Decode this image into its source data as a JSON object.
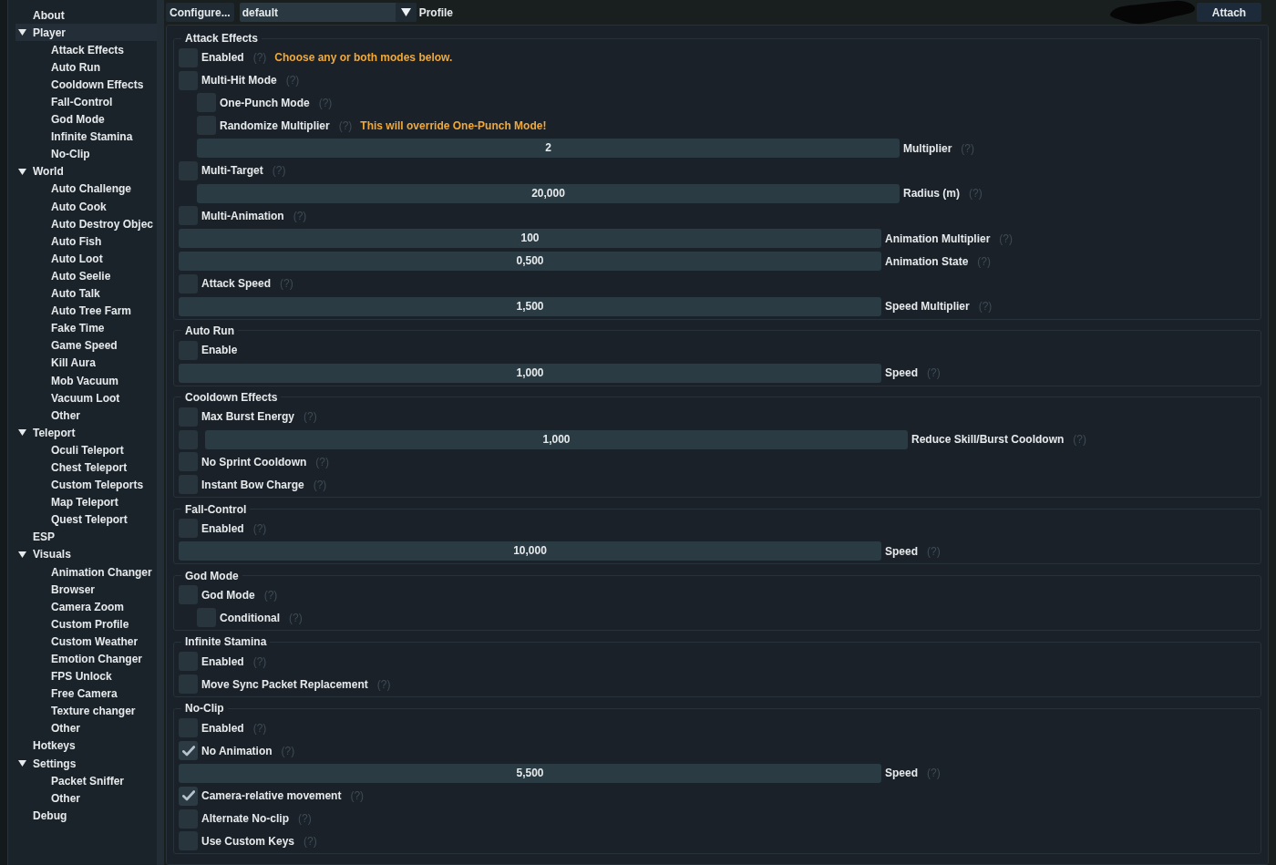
{
  "top_bar": {
    "configure_button": "Configure...",
    "profile_select": {
      "value": "default"
    },
    "profile_label": "Profile",
    "attach_button": "Attach"
  },
  "sidebar": {
    "items": [
      {
        "label": "About",
        "selected": false
      },
      {
        "label": "Player",
        "selected": true,
        "expanded": true,
        "children": [
          {
            "label": "Attack Effects",
            "selected": false
          },
          {
            "label": "Auto Run",
            "selected": false
          },
          {
            "label": "Cooldown Effects",
            "selected": false
          },
          {
            "label": "Fall-Control",
            "selected": false
          },
          {
            "label": "God Mode",
            "selected": false
          },
          {
            "label": "Infinite Stamina",
            "selected": false
          },
          {
            "label": "No-Clip",
            "selected": false
          }
        ]
      },
      {
        "label": "World",
        "selected": false,
        "expanded": true,
        "children": [
          {
            "label": "Auto Challenge",
            "selected": false
          },
          {
            "label": "Auto Cook",
            "selected": false
          },
          {
            "label": "Auto Destroy Objec",
            "selected": false
          },
          {
            "label": "Auto Fish",
            "selected": false
          },
          {
            "label": "Auto Loot",
            "selected": false
          },
          {
            "label": "Auto Seelie",
            "selected": false
          },
          {
            "label": "Auto Talk",
            "selected": false
          },
          {
            "label": "Auto Tree Farm",
            "selected": false
          },
          {
            "label": "Fake Time",
            "selected": false
          },
          {
            "label": "Game Speed",
            "selected": false
          },
          {
            "label": "Kill Aura",
            "selected": false
          },
          {
            "label": "Mob Vacuum",
            "selected": false
          },
          {
            "label": "Vacuum Loot",
            "selected": false
          },
          {
            "label": "Other",
            "selected": false
          }
        ]
      },
      {
        "label": "Teleport",
        "selected": false,
        "expanded": true,
        "children": [
          {
            "label": "Oculi Teleport",
            "selected": false
          },
          {
            "label": "Chest Teleport",
            "selected": false
          },
          {
            "label": "Custom Teleports",
            "selected": false
          },
          {
            "label": "Map Teleport",
            "selected": false
          },
          {
            "label": "Quest Teleport",
            "selected": false
          }
        ]
      },
      {
        "label": "ESP",
        "selected": false
      },
      {
        "label": "Visuals",
        "selected": false,
        "expanded": true,
        "children": [
          {
            "label": "Animation Changer",
            "selected": false
          },
          {
            "label": "Browser",
            "selected": false
          },
          {
            "label": "Camera Zoom",
            "selected": false
          },
          {
            "label": "Custom Profile",
            "selected": false
          },
          {
            "label": "Custom Weather",
            "selected": false
          },
          {
            "label": "Emotion Changer",
            "selected": false
          },
          {
            "label": "FPS Unlock",
            "selected": false
          },
          {
            "label": "Free Camera",
            "selected": false
          },
          {
            "label": "Texture changer",
            "selected": false
          },
          {
            "label": "Other",
            "selected": false
          }
        ]
      },
      {
        "label": "Hotkeys",
        "selected": false
      },
      {
        "label": "Settings",
        "selected": false,
        "expanded": true,
        "children": [
          {
            "label": "Packet Sniffer",
            "selected": false
          },
          {
            "label": "Other",
            "selected": false
          }
        ]
      },
      {
        "label": "Debug",
        "selected": false
      }
    ]
  },
  "groups": [
    {
      "title": "Attack Effects",
      "items": [
        {
          "kind": "checkbox",
          "label": "Enabled",
          "checked": false,
          "help": "(?)",
          "note": "Choose any or both modes below."
        },
        {
          "kind": "checkbox",
          "label": "Multi-Hit Mode",
          "checked": false,
          "help": "(?)",
          "children": [
            {
              "kind": "checkbox",
              "label": "One-Punch Mode",
              "checked": false,
              "help": "(?)"
            },
            {
              "kind": "checkbox",
              "label": "Randomize Multiplier",
              "checked": false,
              "help": "(?)",
              "note": "This will override One-Punch Mode!"
            },
            {
              "kind": "number",
              "value": "2",
              "label": "Multiplier",
              "help": "(?)"
            }
          ]
        },
        {
          "kind": "checkbox",
          "label": "Multi-Target",
          "checked": false,
          "help": "(?)",
          "children": [
            {
              "kind": "number",
              "value": "20,000",
              "label": "Radius (m)",
              "help": "(?)"
            }
          ]
        },
        {
          "kind": "checkbox",
          "label": "Multi-Animation",
          "checked": false,
          "help": "(?)"
        },
        {
          "kind": "number",
          "value": "100",
          "label": "Animation Multiplier",
          "help": "(?)"
        },
        {
          "kind": "number",
          "value": "0,500",
          "label": "Animation State",
          "help": "(?)"
        },
        {
          "kind": "checkbox",
          "label": "Attack Speed",
          "checked": false,
          "help": "(?)"
        },
        {
          "kind": "number",
          "value": "1,500",
          "label": "Speed Multiplier",
          "help": "(?)"
        }
      ]
    },
    {
      "title": "Auto Run",
      "items": [
        {
          "kind": "checkbox",
          "label": "Enable",
          "checked": false
        },
        {
          "kind": "number",
          "value": "1,000",
          "label": "Speed",
          "help": "(?)"
        }
      ]
    },
    {
      "title": "Cooldown Effects",
      "items": [
        {
          "kind": "checkbox",
          "label": "Max Burst Energy",
          "checked": false,
          "help": "(?)"
        },
        {
          "kind": "checkbox_number",
          "checked": false,
          "value": "1,000",
          "label": "Reduce Skill/Burst Cooldown",
          "help": "(?)"
        },
        {
          "kind": "checkbox",
          "label": "No Sprint Cooldown",
          "checked": false,
          "help": "(?)"
        },
        {
          "kind": "checkbox",
          "label": "Instant Bow Charge",
          "checked": false,
          "help": "(?)"
        }
      ]
    },
    {
      "title": "Fall-Control",
      "items": [
        {
          "kind": "checkbox",
          "label": "Enabled",
          "checked": false,
          "help": "(?)"
        },
        {
          "kind": "number",
          "value": "10,000",
          "label": "Speed",
          "help": "(?)"
        }
      ]
    },
    {
      "title": "God Mode",
      "items": [
        {
          "kind": "checkbox",
          "label": "God Mode",
          "checked": false,
          "help": "(?)",
          "children": [
            {
              "kind": "checkbox",
              "label": "Conditional",
              "checked": false,
              "help": "(?)"
            }
          ]
        }
      ]
    },
    {
      "title": "Infinite Stamina",
      "items": [
        {
          "kind": "checkbox",
          "label": "Enabled",
          "checked": false,
          "help": "(?)"
        },
        {
          "kind": "checkbox",
          "label": "Move Sync Packet Replacement",
          "checked": false,
          "help": "(?)"
        }
      ]
    },
    {
      "title": "No-Clip",
      "items": [
        {
          "kind": "checkbox",
          "label": "Enabled",
          "checked": false,
          "help": "(?)"
        },
        {
          "kind": "checkbox",
          "label": "No Animation",
          "checked": true,
          "help": "(?)"
        },
        {
          "kind": "number",
          "value": "5,500",
          "label": "Speed",
          "help": "(?)"
        },
        {
          "kind": "checkbox",
          "label": "Camera-relative movement",
          "checked": true,
          "help": "(?)"
        },
        {
          "kind": "checkbox",
          "label": "Alternate No-clip",
          "checked": false,
          "help": "(?)"
        },
        {
          "kind": "checkbox",
          "label": "Use Custom Keys",
          "checked": false,
          "help": "(?)"
        }
      ]
    }
  ]
}
